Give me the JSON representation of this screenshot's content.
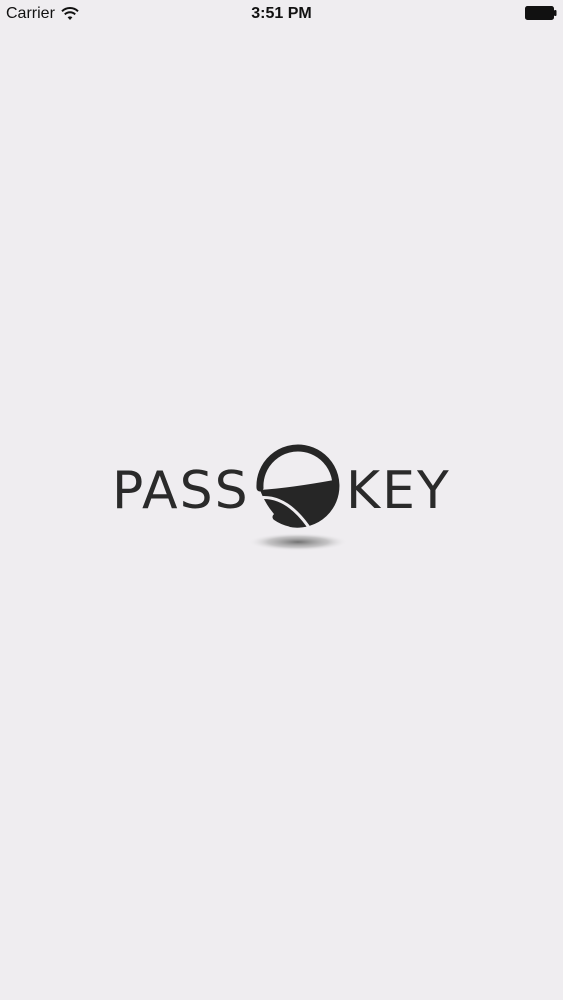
{
  "status_bar": {
    "carrier": "Carrier",
    "time": "3:51 PM",
    "icons": [
      "wifi-icon",
      "battery-icon"
    ]
  },
  "splash": {
    "logo_left": "PASS",
    "logo_right": "KEY",
    "emblem_icon": "passkey-emblem-icon"
  }
}
